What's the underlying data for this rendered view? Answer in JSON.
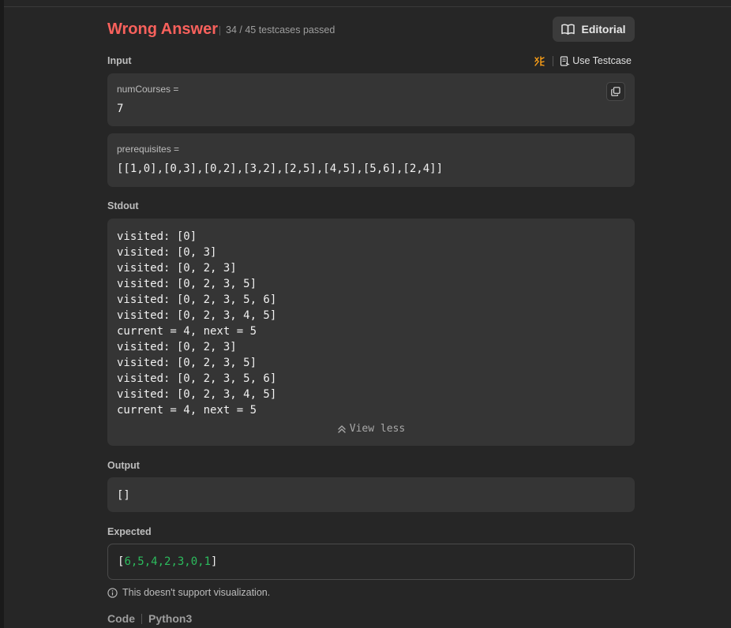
{
  "header": {
    "status": "Wrong Answer",
    "testcases": "34 / 45 testcases passed",
    "editorial_label": "Editorial"
  },
  "input": {
    "label": "Input",
    "use_testcase_label": "Use Testcase",
    "vars": [
      {
        "name": "numCourses =",
        "value": "7"
      },
      {
        "name": "prerequisites =",
        "value": "[[1,0],[0,3],[0,2],[3,2],[2,5],[4,5],[5,6],[2,4]]"
      }
    ]
  },
  "stdout": {
    "label": "Stdout",
    "lines": [
      "visited: [0]",
      "visited: [0, 3]",
      "visited: [0, 2, 3]",
      "visited: [0, 2, 3, 5]",
      "visited: [0, 2, 3, 5, 6]",
      "visited: [0, 2, 3, 4, 5]",
      "current = 4, next = 5",
      "visited: [0, 2, 3]",
      "visited: [0, 2, 3, 5]",
      "visited: [0, 2, 3, 5, 6]",
      "visited: [0, 2, 3, 4, 5]",
      "current = 4, next = 5"
    ],
    "view_less_label": "View less"
  },
  "output": {
    "label": "Output",
    "value": "[]"
  },
  "expected": {
    "label": "Expected",
    "open_bracket": "[",
    "values": "6,5,4,2,3,0,1",
    "close_bracket": "]"
  },
  "visualization_note": "This doesn't support visualization.",
  "code": {
    "label": "Code",
    "language": "Python3"
  },
  "colors": {
    "status_error": "#f8615c",
    "accent_green": "#2cbb5d",
    "debug_icon": "#ffa116"
  }
}
